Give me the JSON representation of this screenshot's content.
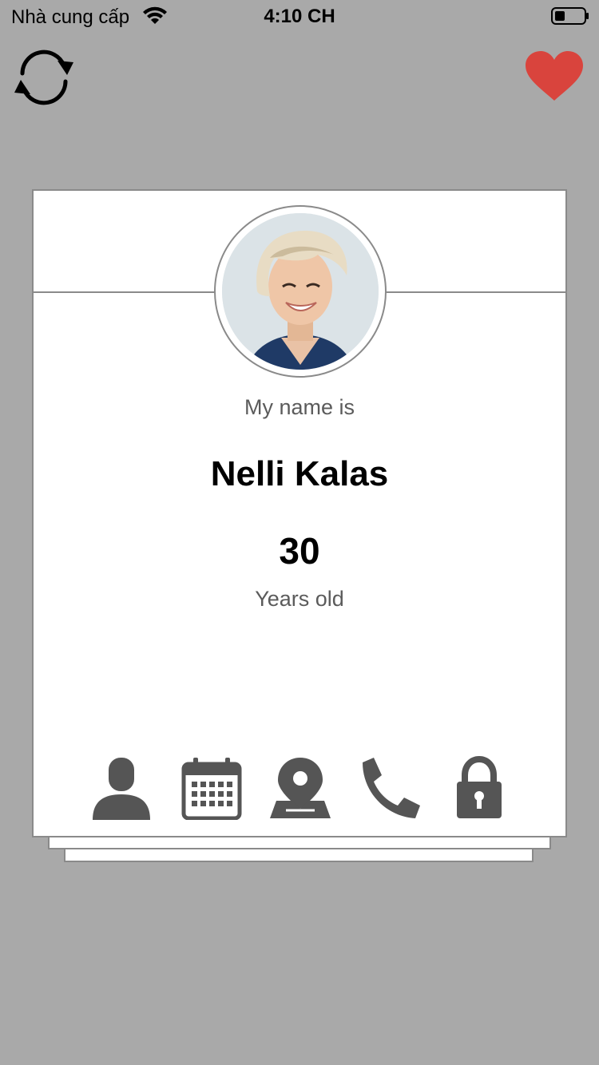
{
  "status_bar": {
    "carrier": "Nhà cung cấp",
    "time": "4:10 CH"
  },
  "icons": {
    "refresh": "refresh-icon",
    "favorite": "heart-icon",
    "tabs": [
      "user-icon",
      "calendar-icon",
      "map-pin-icon",
      "phone-icon",
      "lock-icon"
    ]
  },
  "colors": {
    "background": "#a9a9a9",
    "heart": "#d9443d",
    "icon": "#555555"
  },
  "profile": {
    "intro": "My name is",
    "name": "Nelli Kalas",
    "age": "30",
    "age_label": "Years old"
  }
}
